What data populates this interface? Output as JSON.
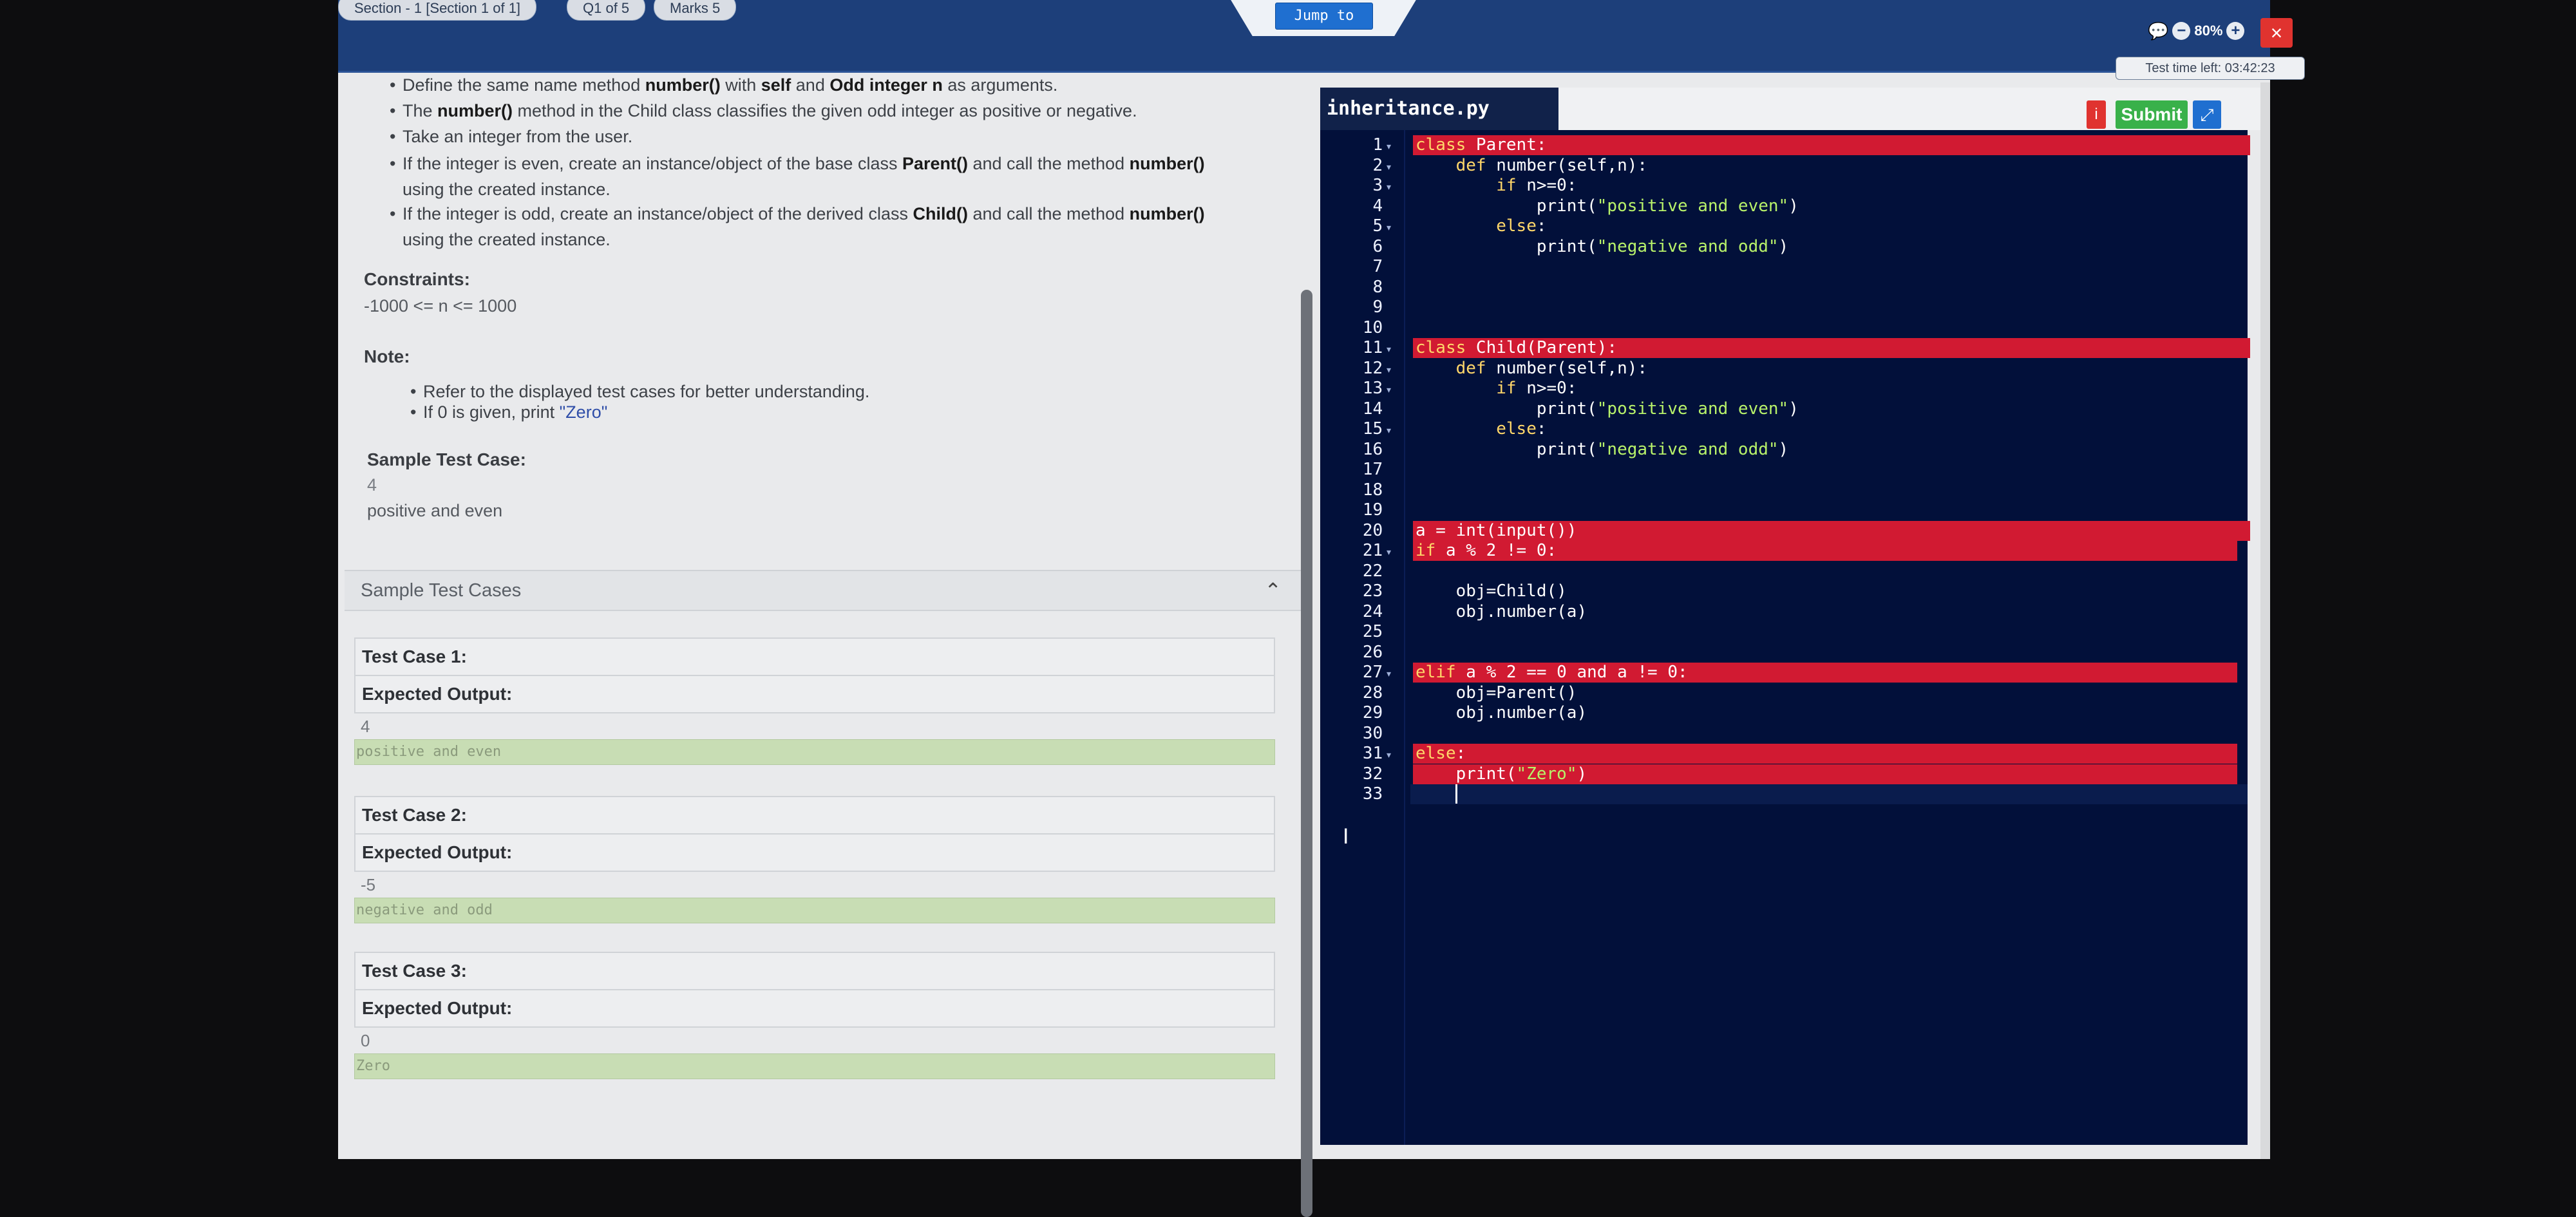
{
  "header": {
    "section_pill": "Section - 1 [Section 1 of 1]",
    "question_pill": "Q1 of 5",
    "marks_pill": "Marks 5",
    "jump_button": "Jump to",
    "zoom_level": "80%",
    "close_label": "×",
    "timer": "Test time left: 03:42:23"
  },
  "question": {
    "bullets": [
      {
        "pre": "Define the same name method ",
        "b1": "number()",
        "mid": " with ",
        "b2": "self",
        "mid2": " and ",
        "b3": "Odd integer n",
        "post": " as arguments."
      },
      {
        "pre": "The ",
        "b1": "number()",
        "post": " method in the Child class classifies the given odd integer as positive or negative."
      },
      {
        "text": "Take an integer from the user."
      },
      {
        "pre": "If the integer is even, create an instance/object of the base class ",
        "b1": "Parent()",
        "mid": " and call the method ",
        "b2": "number()",
        "line2": "using the created instance."
      },
      {
        "pre": "If the integer is odd, create an instance/object of the derived class ",
        "b1": "Child()",
        "mid": " and call the method ",
        "b2": "number()",
        "line2": "using the created instance."
      }
    ],
    "constraints_title": "Constraints:",
    "constraints_text": "-1000 <= n <= 1000",
    "note_title": "Note:",
    "note_bullets": [
      "Refer to the displayed test cases for better understanding.",
      "If 0 is given, print "
    ],
    "note_zero": "\"Zero\"",
    "sample_title": "Sample Test Case:",
    "sample_input": "4",
    "sample_output": "positive and even"
  },
  "sample_cases": {
    "header": "Sample Test Cases",
    "cases": [
      {
        "title": "Test Case 1:",
        "expected": "Expected Output:",
        "input": "4",
        "output": "positive and even"
      },
      {
        "title": "Test Case 2:",
        "expected": "Expected Output:",
        "input": "-5",
        "output": "negative and odd"
      },
      {
        "title": "Test Case 3:",
        "expected": "Expected Output:",
        "input": "0",
        "output": "Zero"
      }
    ]
  },
  "editor": {
    "filename": "inheritance.py",
    "help_label": "i",
    "submit_label": "Submit",
    "expand_label": "⤢",
    "lines": [
      "class Parent:",
      "    def number(self,n):",
      "        if n>=0:",
      "            print(\"positive and even\")",
      "        else:",
      "            print(\"negative and odd\")",
      "",
      "",
      "",
      "",
      "class Child(Parent):",
      "    def number(self,n):",
      "        if n>=0:",
      "            print(\"positive and even\")",
      "        else:",
      "            print(\"negative and odd\")",
      "",
      "",
      "",
      "a = int(input())",
      "if a % 2 != 0:",
      "",
      "    obj=Child()",
      "    obj.number(a)",
      "",
      "",
      "elif a % 2 == 0 and a != 0:",
      "    obj=Parent()",
      "    obj.number(a)",
      "",
      "else:",
      "    print(\"Zero\")",
      ""
    ],
    "error_lines": [
      1,
      11,
      20,
      21,
      27,
      31,
      32
    ],
    "fold_lines": [
      1,
      2,
      3,
      5,
      11,
      12,
      13,
      15,
      21,
      27,
      31
    ]
  }
}
